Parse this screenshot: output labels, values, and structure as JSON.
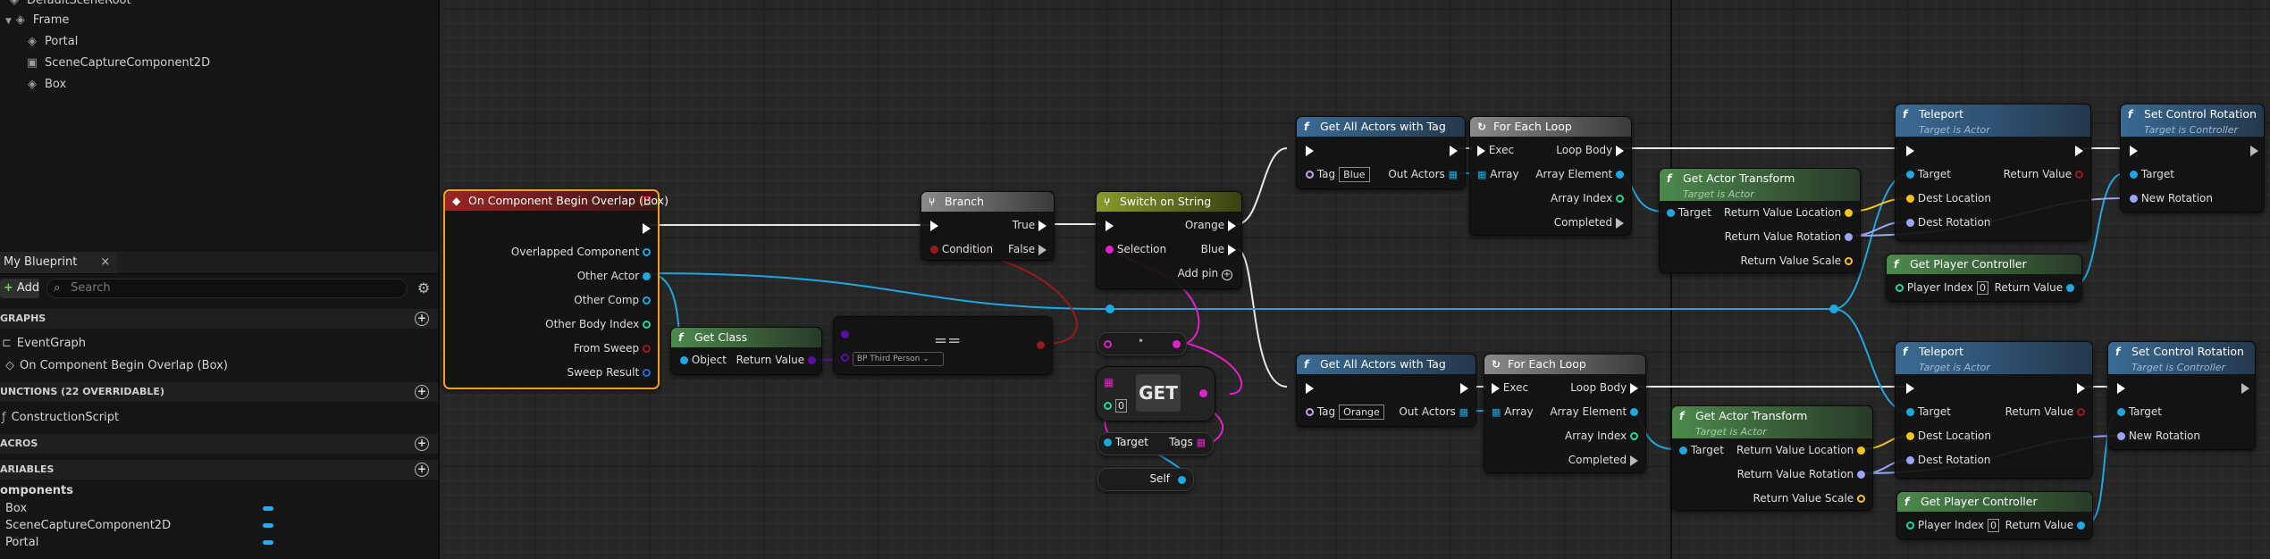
{
  "outliner": {
    "root": "DefaultSceneRoot",
    "frame": "Frame",
    "children": [
      "Portal",
      "SceneCaptureComponent2D",
      "Box"
    ]
  },
  "my_blueprint": {
    "tab_label": "My Blueprint",
    "close": "×",
    "add_label": "Add",
    "search_placeholder": "Search",
    "graphs_header": "GRAPHS",
    "graph_items": [
      "EventGraph",
      "On Component Begin Overlap (Box)"
    ],
    "functions_header": "UNCTIONS (22 OVERRIDABLE)",
    "function_items": [
      "ConstructionScript"
    ],
    "macros_header": "ACROS",
    "variables_header": "ARIABLES",
    "components_label": "omponents",
    "variable_items": [
      "Box",
      "SceneCaptureComponent2D",
      "Portal"
    ]
  },
  "nodes": {
    "event": {
      "title": "On Component Begin Overlap (Box)",
      "pins": [
        "Overlapped Component",
        "Other Actor",
        "Other Comp",
        "Other Body Index",
        "From Sweep",
        "Sweep Result"
      ]
    },
    "branch": {
      "title": "Branch",
      "condition": "Condition",
      "true": "True",
      "false": "False"
    },
    "switch": {
      "title": "Switch on String",
      "selection": "Selection",
      "orange": "Orange",
      "blue": "Blue",
      "add_pin": "Add pin"
    },
    "get_class": {
      "title": "Get Class",
      "object": "Object",
      "return": "Return Value"
    },
    "equal": {
      "class_value": "BP Third Person",
      "op": "=="
    },
    "get_node": {
      "label": "GET",
      "index": "0"
    },
    "tags_node": {
      "target": "Target",
      "tags": "Tags"
    },
    "self_node": {
      "label": "Self"
    },
    "get_all_blue": {
      "title": "Get All Actors with Tag",
      "tag": "Tag",
      "tag_value": "Blue",
      "out": "Out Actors"
    },
    "get_all_orange": {
      "title": "Get All Actors with Tag",
      "tag": "Tag",
      "tag_value": "Orange",
      "out": "Out Actors"
    },
    "loop_top": {
      "title": "For Each Loop",
      "exec": "Exec",
      "array": "Array",
      "body": "Loop Body",
      "element": "Array Element",
      "index": "Array Index",
      "completed": "Completed"
    },
    "loop_bot": {
      "title": "For Each Loop",
      "exec": "Exec",
      "array": "Array",
      "body": "Loop Body",
      "element": "Array Element",
      "index": "Array Index",
      "completed": "Completed"
    },
    "transform_top": {
      "title": "Get Actor Transform",
      "subtitle": "Target is Actor",
      "target": "Target",
      "loc": "Return Value Location",
      "rot": "Return Value Rotation",
      "scale": "Return Value Scale"
    },
    "transform_bot": {
      "title": "Get Actor Transform",
      "subtitle": "Target is Actor",
      "target": "Target",
      "loc": "Return Value Location",
      "rot": "Return Value Rotation",
      "scale": "Return Value Scale"
    },
    "teleport_top": {
      "title": "Teleport",
      "subtitle": "Target is Actor",
      "target": "Target",
      "ret": "Return Value",
      "dest_loc": "Dest Location",
      "dest_rot": "Dest Rotation"
    },
    "teleport_bot": {
      "title": "Teleport",
      "subtitle": "Target is Actor",
      "target": "Target",
      "ret": "Return Value",
      "dest_loc": "Dest Location",
      "dest_rot": "Dest Rotation"
    },
    "pc_top": {
      "title": "Get Player Controller",
      "index_label": "Player Index",
      "index": "0",
      "ret": "Return Value"
    },
    "pc_bot": {
      "title": "Get Player Controller",
      "index_label": "Player Index",
      "index": "0",
      "ret": "Return Value"
    },
    "scr_top": {
      "title": "Set Control Rotation",
      "subtitle": "Target is Controller",
      "target": "Target",
      "rot": "New Rotation"
    },
    "scr_bot": {
      "title": "Set Control Rotation",
      "subtitle": "Target is Controller",
      "target": "Target",
      "rot": "New Rotation"
    }
  },
  "colors": {
    "exec": "#ffffff",
    "object": "#1ea7e1",
    "class": "#5a0ea5",
    "bool": "#9a1a1a",
    "string": "#e022c8",
    "vector": "#f5c518",
    "rotator": "#9aa6f5",
    "transform": "#f08c1e",
    "int": "#1fd8a0",
    "struct": "#1f6bd8"
  },
  "icons": {
    "event": "event-diamond-icon",
    "function": "function-f-icon",
    "branch": "branch-icon",
    "loop": "loop-icon",
    "settings": "gear-icon",
    "search": "search-icon",
    "add": "plus-icon",
    "section_add": "circle-plus-icon",
    "component": "component-icon"
  }
}
